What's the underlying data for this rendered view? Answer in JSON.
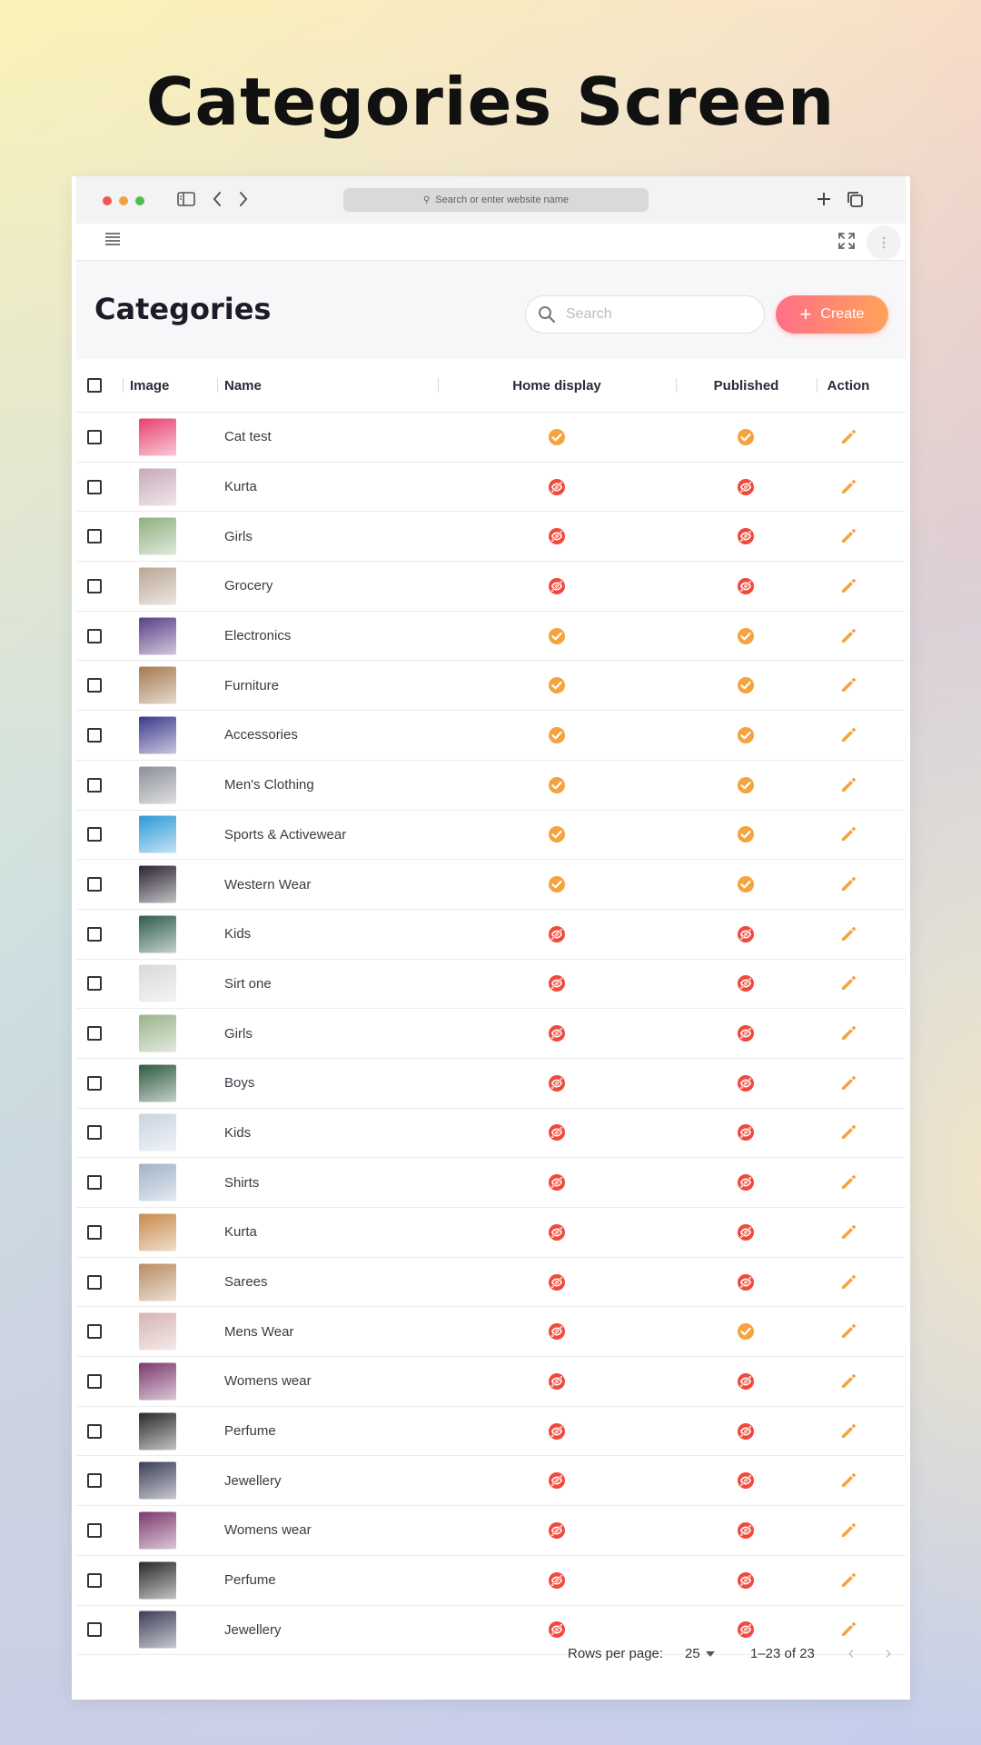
{
  "banner": {
    "title": "Categories Screen"
  },
  "browser": {
    "url_placeholder": "Search or enter website name"
  },
  "page": {
    "title": "Categories",
    "search_placeholder": "Search",
    "create_label": "Create"
  },
  "table": {
    "headers": {
      "image": "Image",
      "name": "Name",
      "home_display": "Home display",
      "published": "Published",
      "action": "Action"
    },
    "rows": [
      {
        "name": "Cat test",
        "home": true,
        "published": true,
        "thumb": "#e8416f"
      },
      {
        "name": "Kurta",
        "home": false,
        "published": false,
        "thumb": "#c7a9b9"
      },
      {
        "name": "Girls",
        "home": false,
        "published": false,
        "thumb": "#8fb07f"
      },
      {
        "name": "Grocery",
        "home": false,
        "published": false,
        "thumb": "#b9a794"
      },
      {
        "name": "Electronics",
        "home": true,
        "published": true,
        "thumb": "#5b3f86"
      },
      {
        "name": "Furniture",
        "home": true,
        "published": true,
        "thumb": "#a67a50"
      },
      {
        "name": "Accessories",
        "home": true,
        "published": true,
        "thumb": "#3d3a8c"
      },
      {
        "name": "Men's Clothing",
        "home": true,
        "published": true,
        "thumb": "#8c8f99"
      },
      {
        "name": "Sports & Activewear",
        "home": true,
        "published": true,
        "thumb": "#2e9ad6"
      },
      {
        "name": "Western Wear",
        "home": true,
        "published": true,
        "thumb": "#2a2432"
      },
      {
        "name": "Kids",
        "home": false,
        "published": false,
        "thumb": "#2f5d4a"
      },
      {
        "name": "Sirt one",
        "home": false,
        "published": false,
        "thumb": "#d9d9d9"
      },
      {
        "name": "Girls",
        "home": false,
        "published": false,
        "thumb": "#9ab38a"
      },
      {
        "name": "Boys",
        "home": false,
        "published": false,
        "thumb": "#2e5b40"
      },
      {
        "name": "Kids",
        "home": false,
        "published": false,
        "thumb": "#c8d4e0"
      },
      {
        "name": "Shirts",
        "home": false,
        "published": false,
        "thumb": "#9fb2c8"
      },
      {
        "name": "Kurta",
        "home": false,
        "published": false,
        "thumb": "#c8894c"
      },
      {
        "name": "Sarees",
        "home": false,
        "published": false,
        "thumb": "#b98c64"
      },
      {
        "name": "Mens Wear",
        "home": false,
        "published": true,
        "thumb": "#d7b3b3"
      },
      {
        "name": "Womens wear",
        "home": false,
        "published": false,
        "thumb": "#7c3a6e"
      },
      {
        "name": "Perfume",
        "home": false,
        "published": false,
        "thumb": "#2a2a2a"
      },
      {
        "name": "Jewellery",
        "home": false,
        "published": false,
        "thumb": "#3c3e58"
      },
      {
        "name": "Womens wear",
        "home": false,
        "published": false,
        "thumb": "#7c3a6e"
      },
      {
        "name": "Perfume",
        "home": false,
        "published": false,
        "thumb": "#2a2a2a"
      },
      {
        "name": "Jewellery",
        "home": false,
        "published": false,
        "thumb": "#3c3e58"
      }
    ]
  },
  "pagination": {
    "rows_per_page_label": "Rows per page:",
    "rows_per_page_value": "25",
    "range": "1–23 of 23"
  },
  "colors": {
    "accent_orange": "#f5a33e",
    "status_red": "#ef4a3c",
    "edit_orange": "#f5a33e"
  },
  "icons": {
    "published_true": "check-circle-icon",
    "published_false": "eye-off-circle-icon",
    "edit": "pencil-icon"
  }
}
